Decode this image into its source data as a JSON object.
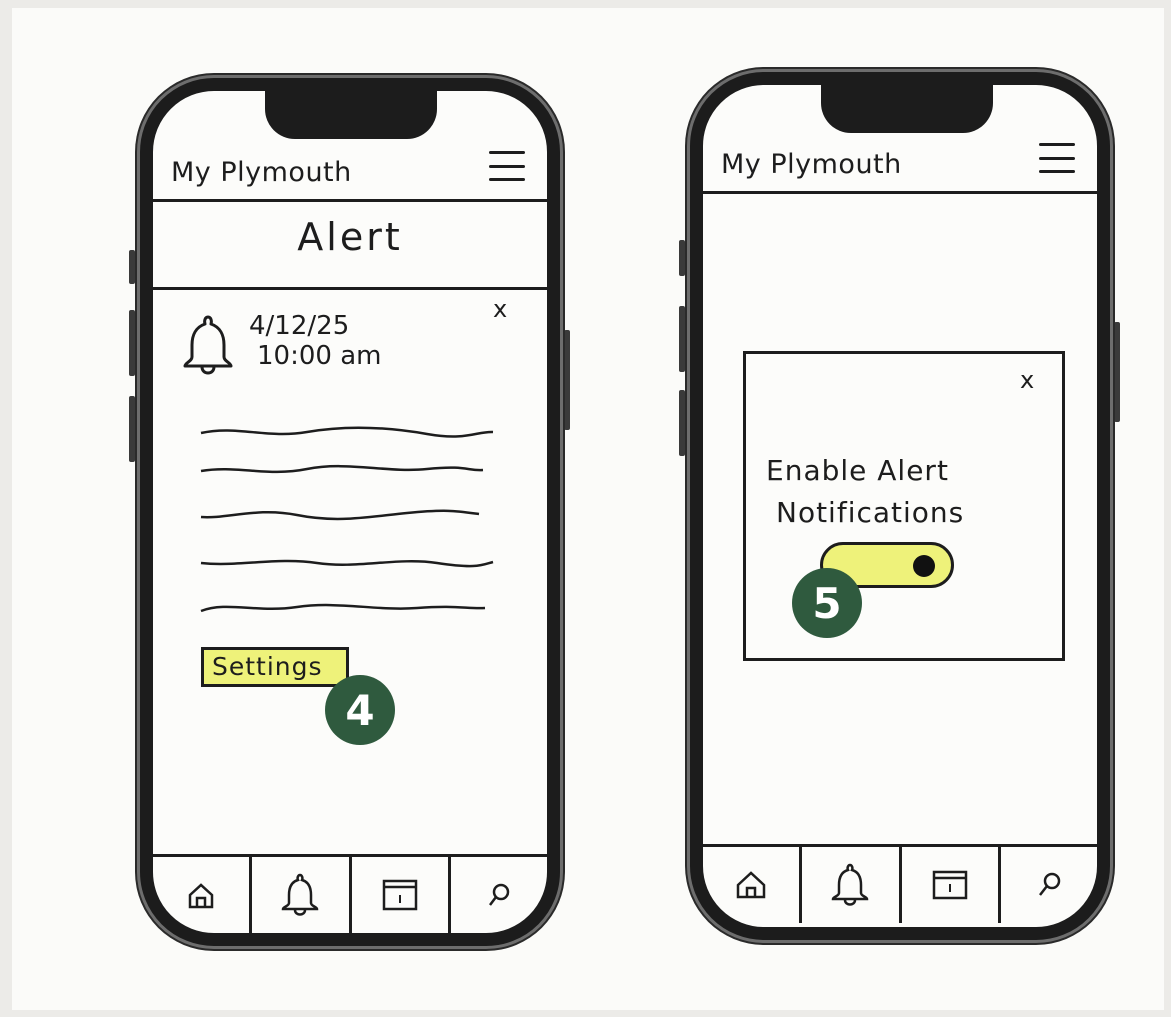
{
  "screens": [
    {
      "app_title": "My Plymouth",
      "page_title": "Alert",
      "alert": {
        "date": "4/12/25",
        "time": "10:00 am"
      },
      "settings_label": "Settings",
      "step_badge": "4",
      "tabs": [
        "home-icon",
        "bell-icon",
        "calendar-icon",
        "search-icon"
      ]
    },
    {
      "app_title": "My Plymouth",
      "modal": {
        "line1": "Enable Alert",
        "line2": "Notifications",
        "toggle_on": true
      },
      "step_badge": "5",
      "tabs": [
        "home-icon",
        "bell-icon",
        "calendar-icon",
        "search-icon"
      ]
    }
  ],
  "colors": {
    "highlight": "#eef27a",
    "badge": "#2f5a3e",
    "ink": "#1d1d1d"
  },
  "close_glyph": "x"
}
